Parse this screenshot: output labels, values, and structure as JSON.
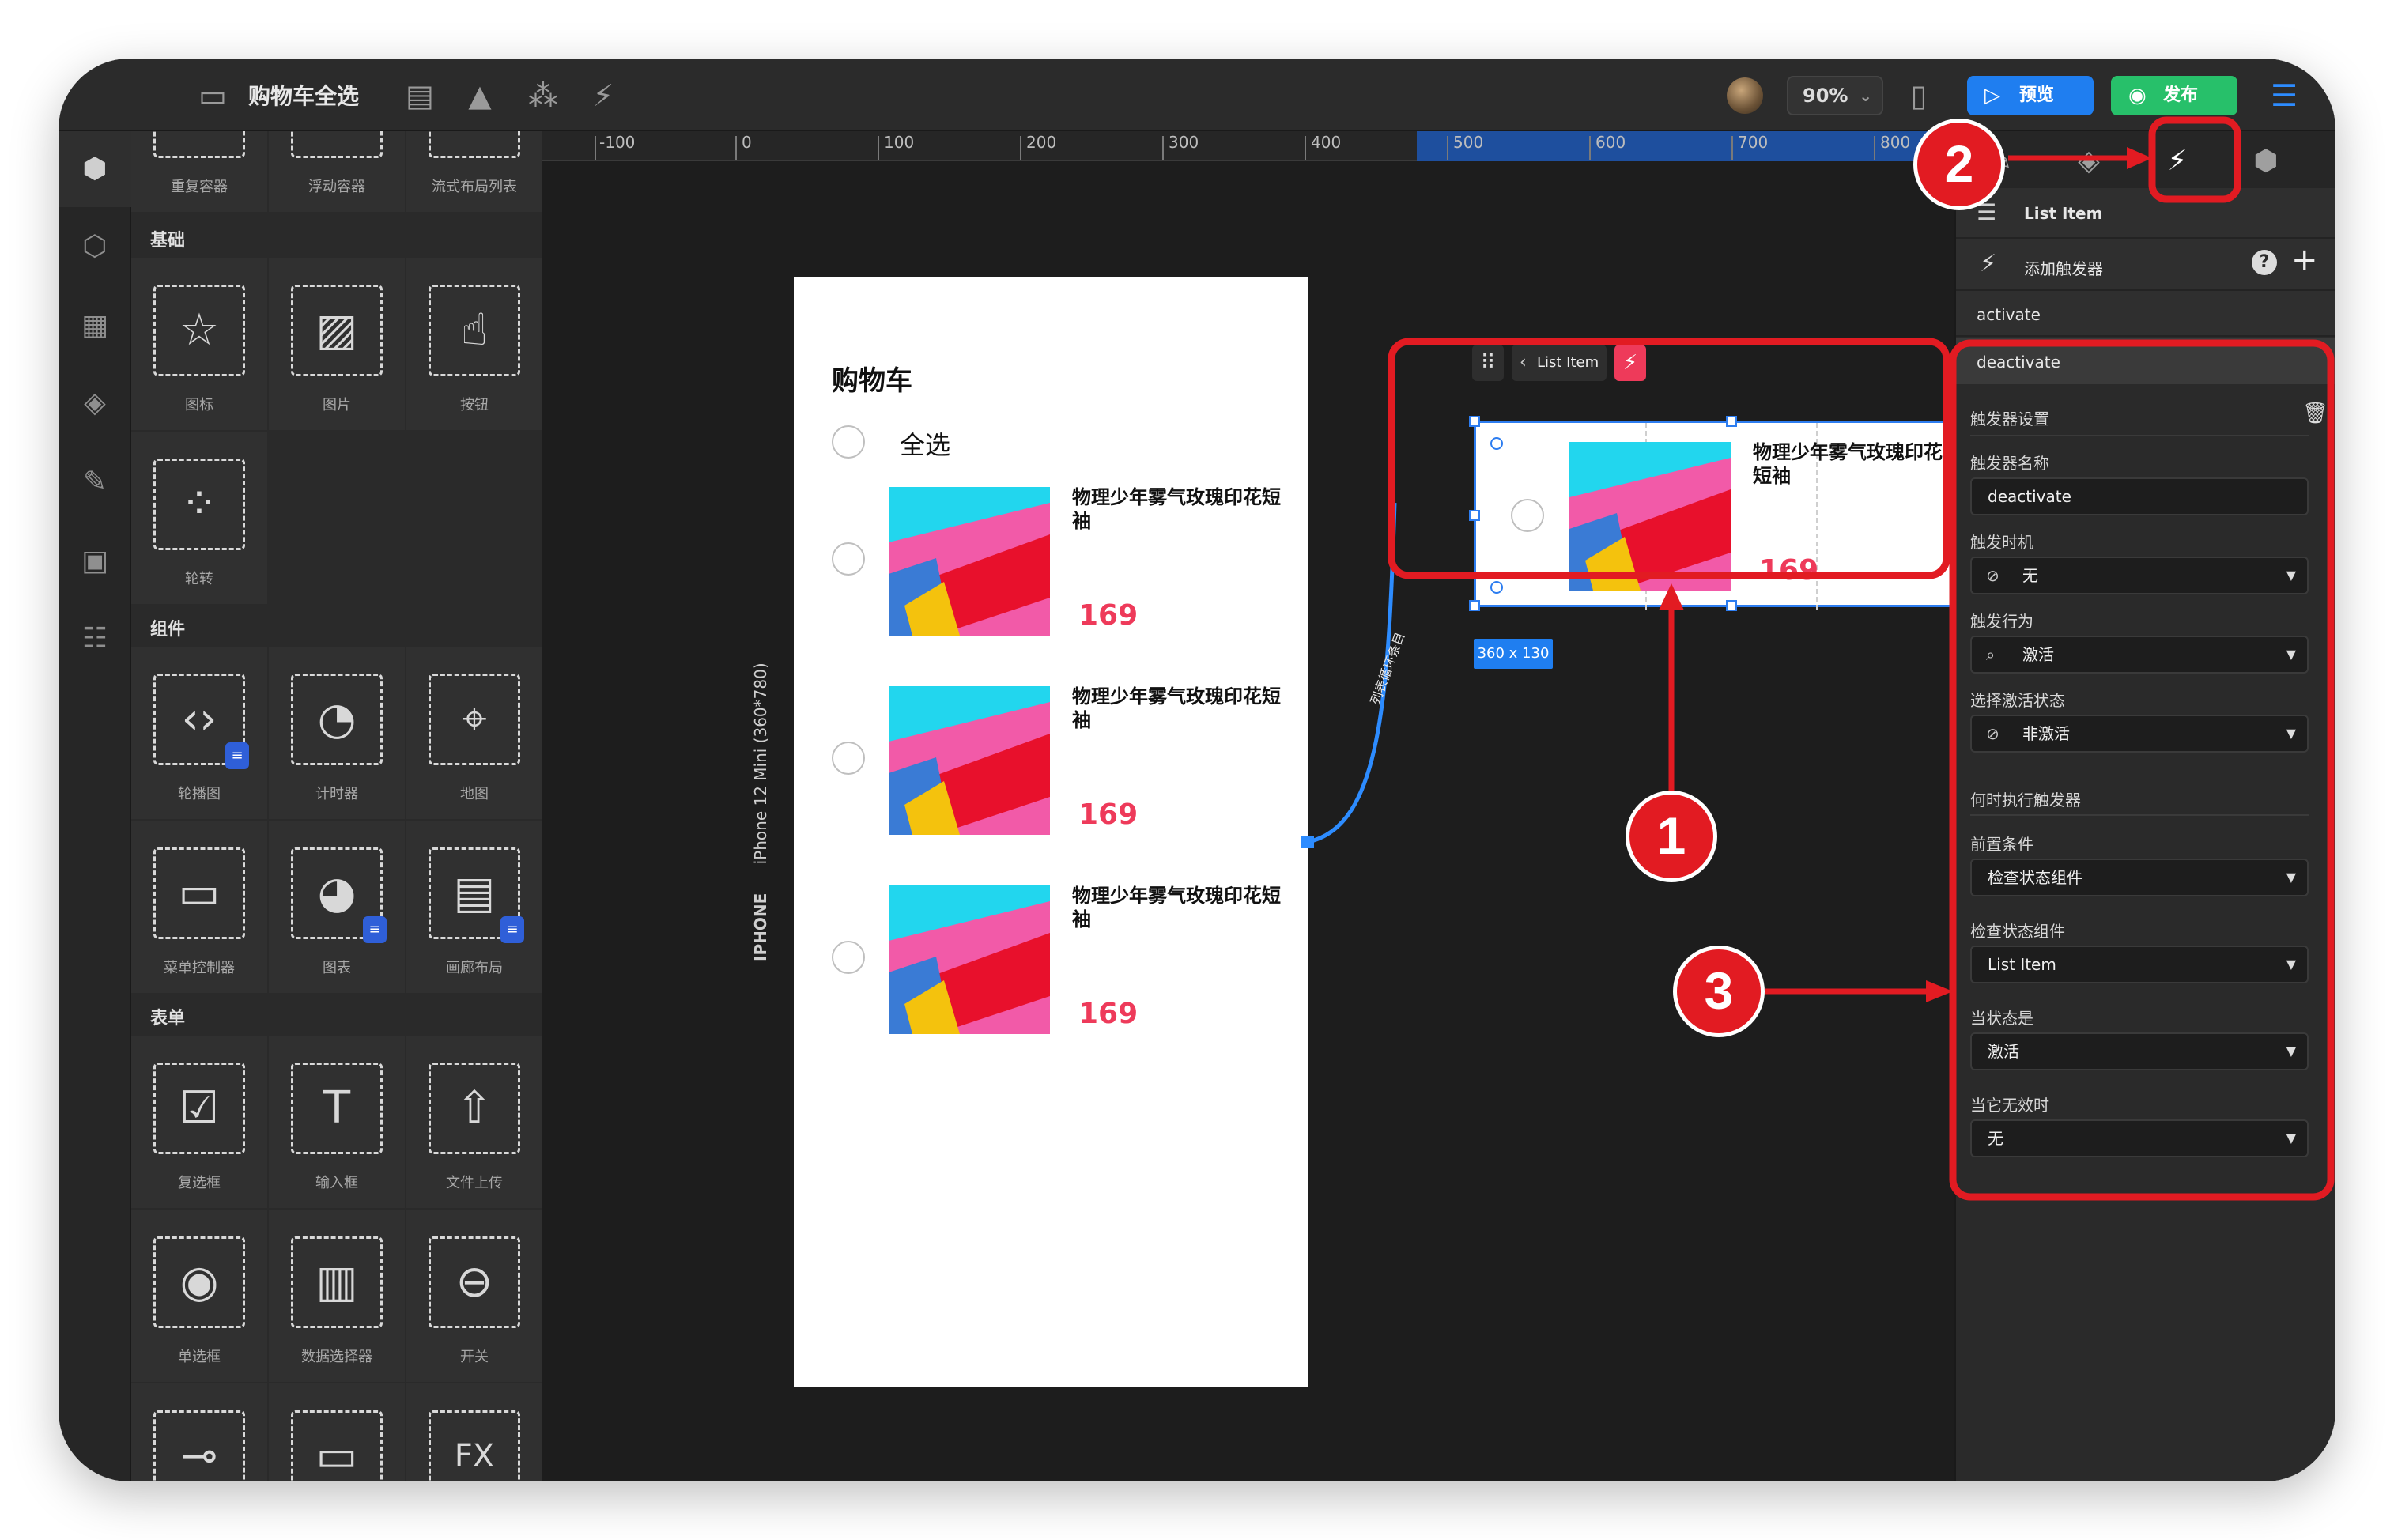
{
  "window": {
    "title": "购物车全选"
  },
  "topbar": {
    "zoom": "90%",
    "preview_label": "预览",
    "publish_label": "发布"
  },
  "palette": {
    "top_row": [
      "重复容器",
      "浮动容器",
      "流式布局列表"
    ],
    "sections": [
      {
        "title": "基础",
        "items": [
          "图标",
          "图片",
          "按钮",
          "轮转"
        ]
      },
      {
        "title": "组件",
        "items": [
          "轮播图",
          "计时器",
          "地图",
          "菜单控制器",
          "图表",
          "画廊布局"
        ]
      },
      {
        "title": "表单",
        "items": [
          "复选框",
          "输入框",
          "文件上传",
          "单选框",
          "数据选择器",
          "开关"
        ]
      }
    ]
  },
  "ruler": {
    "ticks": [
      "-100",
      "0",
      "100",
      "200",
      "300",
      "400",
      "500",
      "600",
      "700",
      "800"
    ]
  },
  "phone": {
    "device_label_light": "iPhone 12 Mini (360*780)",
    "device_label_bold": "IPHONE",
    "cart_title": "购物车",
    "select_all": "全选",
    "products": [
      {
        "title": "物理少年雾气玫瑰印花短袖",
        "price": "169"
      },
      {
        "title": "物理少年雾气玫瑰印花短袖",
        "price": "169"
      },
      {
        "title": "物理少年雾气玫瑰印花短袖",
        "price": "169"
      }
    ]
  },
  "list_item": {
    "toolbar_name": "List Item",
    "title": "物理少年雾气玫瑰印花短袖",
    "price": "169",
    "size": "360 x 130",
    "connector_label": "列表循环条目"
  },
  "props": {
    "component_name": "List Item",
    "add_trigger": "添加触发器",
    "triggers": [
      "activate",
      "deactivate"
    ],
    "settings_title": "触发器设置",
    "name_label": "触发器名称",
    "name_value": "deactivate",
    "timing_label": "触发时机",
    "timing_value": "无",
    "action_label": "触发行为",
    "action_value": "激活",
    "state_label": "选择激活状态",
    "state_value": "非激活",
    "when_label": "何时执行触发器",
    "precondition_label": "前置条件",
    "precondition_value": "检查状态组件",
    "check_label": "检查状态组件",
    "check_value": "List Item",
    "when_state_label": "当状态是",
    "when_state_value": "激活",
    "invalid_label": "当它无效时",
    "invalid_value": "无"
  },
  "annotations": {
    "badges": [
      "1",
      "2",
      "3"
    ],
    "color": "#e21b22"
  },
  "colors": {
    "accent_blue": "#1f7ef0",
    "publish_green": "#27c06a",
    "price_red": "#ee3a5a"
  }
}
